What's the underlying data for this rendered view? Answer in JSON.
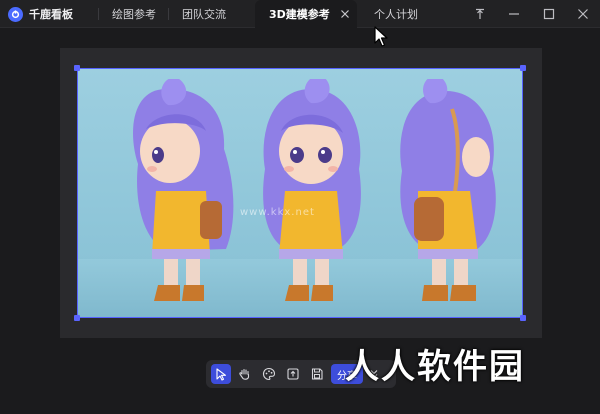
{
  "app": {
    "title": "千鹿看板",
    "logo_icon": "app-logo-icon"
  },
  "tabs": [
    {
      "label": "绘图参考",
      "active": false
    },
    {
      "label": "团队交流",
      "active": false
    },
    {
      "label": "3D建模参考",
      "active": true
    },
    {
      "label": "个人计划",
      "active": false
    }
  ],
  "window": {
    "pin_icon": "pin-icon",
    "minimize_icon": "minimize-icon",
    "maximize_icon": "maximize-icon",
    "close_icon": "close-icon"
  },
  "canvas": {
    "image_watermark": "www.kkx.net",
    "figures": [
      "side-view",
      "front-view",
      "back-view"
    ]
  },
  "toolbar": {
    "tools": [
      "select-icon",
      "hand-icon",
      "palette-icon",
      "image-export-icon",
      "save-icon"
    ],
    "share_label": "分享",
    "more_icon": "double-chevron-down-icon"
  },
  "brand_watermark": "人人软件园",
  "colors": {
    "accent": "#3d4ddb",
    "selection": "#5a64ff",
    "background": "#1b1b1d",
    "hair": "#8f7fe6",
    "jacket": "#f2b72e",
    "boots": "#c8782c"
  }
}
